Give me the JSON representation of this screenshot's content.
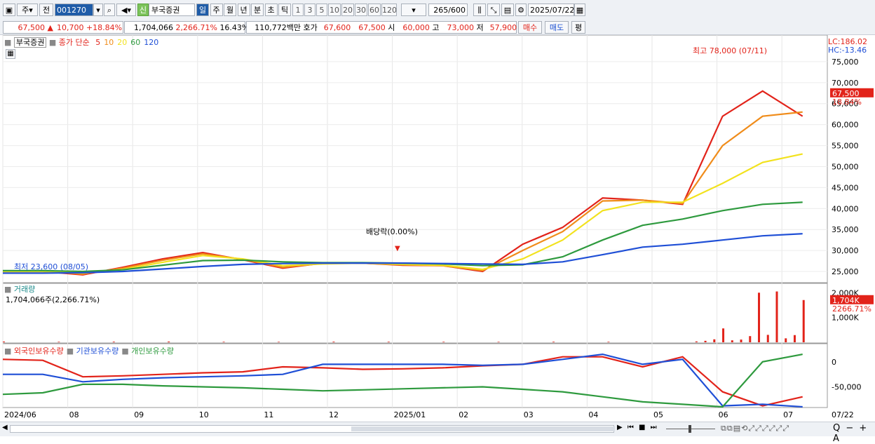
{
  "toolbar": {
    "market": "주",
    "prev": "전",
    "code": "001270",
    "stock_badge": "신",
    "stock_name": "부국증권",
    "period_tabs": [
      "일",
      "주",
      "월",
      "년",
      "분",
      "초",
      "틱"
    ],
    "active_period": "일",
    "intervals": [
      "1",
      "3",
      "5",
      "10",
      "20",
      "30",
      "60",
      "120"
    ],
    "count": "265",
    "count_max": "/600",
    "date": "2025/07/22"
  },
  "quote": {
    "price": "67,500",
    "change": "10,700",
    "change_pct": "+18.84%",
    "volume": "1,704,066",
    "volume_pct": "2,266.71%",
    "turnover_pct": "16.43%",
    "amount": "110,772백만",
    "ask_label": "호가",
    "ask": "67,600",
    "bid": "67,500",
    "open_label": "시",
    "open": "60,000",
    "high_label": "고",
    "high": "73,000",
    "low_label": "저",
    "low": "57,900",
    "buy_btn": "매수",
    "sell_btn": "매도",
    "eval_btn": "평"
  },
  "legend": {
    "name": "부국증권",
    "ma_label": "종가 단순",
    "ma_periods": [
      "5",
      "10",
      "20",
      "60",
      "120"
    ],
    "ma_colors": [
      "#e2231a",
      "#f08c1a",
      "#f2e21e",
      "#2e9a3e",
      "#1f4fd6"
    ],
    "volume_title": "거래량",
    "volume_value": "1,704,066주(2,266.71%)",
    "holdings": [
      "외국인보유수량",
      "기관보유수량",
      "개인보유수량"
    ],
    "holding_colors": [
      "#e2231a",
      "#1f4fd6",
      "#2e9a3e"
    ]
  },
  "annotations": {
    "high": "최고 78,000 (07/11)",
    "low": "최저 23,600 (08/05)",
    "dividend": "배당락(0.00%)",
    "lc": "LC:186.02",
    "hc": "HC:-13.46",
    "last_price_tag": "67,500",
    "last_pct_tag": "18.84%",
    "vol_tag": "1,704K",
    "vol_pct_tag": "2266.71%"
  },
  "chart_data": [
    {
      "type": "line",
      "title": "",
      "x": [
        "2024/06",
        "08",
        "09",
        "10",
        "11",
        "12",
        "2025/01",
        "02",
        "03",
        "04",
        "05",
        "06",
        "07",
        "07/22"
      ],
      "ylim": [
        22500,
        80000
      ],
      "yticks": [
        "75,000",
        "70,000",
        "65,000",
        "60,000",
        "55,000",
        "50,000",
        "45,000",
        "40,000",
        "35,000",
        "30,000",
        "25,000"
      ],
      "series": [
        {
          "name": "5",
          "color": "#e2231a",
          "values": [
            25000,
            25000,
            24200,
            26000,
            28000,
            29500,
            27800,
            25800,
            27000,
            27000,
            26500,
            26400,
            25000,
            31500,
            35500,
            42500,
            42000,
            41000,
            62000,
            68000,
            62000
          ]
        },
        {
          "name": "10",
          "color": "#f08c1a",
          "values": [
            25000,
            25000,
            24400,
            25800,
            27700,
            29200,
            27900,
            26000,
            26900,
            27000,
            26600,
            26400,
            25200,
            30000,
            34500,
            41800,
            42000,
            41200,
            55000,
            62000,
            63000
          ]
        },
        {
          "name": "20",
          "color": "#f2e21e",
          "values": [
            25000,
            25000,
            24600,
            25500,
            27200,
            28800,
            28000,
            26400,
            26800,
            27000,
            26700,
            26500,
            25500,
            28000,
            32500,
            39500,
            41500,
            41500,
            46000,
            51000,
            53000
          ]
        },
        {
          "name": "60",
          "color": "#2e9a3e",
          "values": [
            25200,
            25200,
            25000,
            25400,
            26500,
            27600,
            27700,
            27300,
            27100,
            27100,
            27000,
            26800,
            26400,
            26600,
            28500,
            32500,
            36000,
            37500,
            39500,
            41000,
            41500
          ]
        },
        {
          "name": "120",
          "color": "#1f4fd6",
          "values": [
            24600,
            24600,
            24700,
            25000,
            25600,
            26200,
            26700,
            26900,
            27000,
            27000,
            27000,
            26900,
            26800,
            26700,
            27300,
            29000,
            30800,
            31500,
            32500,
            33500,
            34000
          ]
        }
      ]
    },
    {
      "type": "bar",
      "title": "거래량",
      "ylim": [
        0,
        2150000
      ],
      "yticks": [
        "2,000K",
        "1,000K"
      ],
      "values": [
        30000,
        20000,
        25000,
        30000,
        20000,
        18000,
        25000,
        22000,
        20000,
        18000,
        22000,
        20000,
        35000,
        60000,
        120000,
        560000,
        80000,
        110000,
        250000,
        2000000,
        300000,
        2050000,
        160000,
        290000,
        1704066
      ]
    },
    {
      "type": "line",
      "title": "보유수량",
      "ylim": [
        -90000,
        25000
      ],
      "yticks": [
        "0",
        "-50,000"
      ],
      "series": [
        {
          "name": "외국인보유수량",
          "color": "#e2231a",
          "values": [
            5000,
            3000,
            -30000,
            -28000,
            -25000,
            -22000,
            -20000,
            -10000,
            -12000,
            -15000,
            -14000,
            -12000,
            -8000,
            -5000,
            10000,
            10000,
            -10000,
            10000,
            -60000,
            -88000,
            -70000
          ]
        },
        {
          "name": "기관보유수량",
          "color": "#1f4fd6",
          "values": [
            -25000,
            -25000,
            -40000,
            -35000,
            -32000,
            -30000,
            -28000,
            -25000,
            -5000,
            -5000,
            -5000,
            -5000,
            -7000,
            -5000,
            5000,
            15000,
            -5000,
            5000,
            -88000,
            -85000,
            -90000
          ]
        },
        {
          "name": "개인보유수량",
          "color": "#2e9a3e",
          "values": [
            -65000,
            -62000,
            -45000,
            -45000,
            -48000,
            -50000,
            -52000,
            -55000,
            -58000,
            -56000,
            -54000,
            -52000,
            -50000,
            -55000,
            -60000,
            -70000,
            -80000,
            -85000,
            -90000,
            0,
            15000
          ]
        }
      ]
    }
  ]
}
